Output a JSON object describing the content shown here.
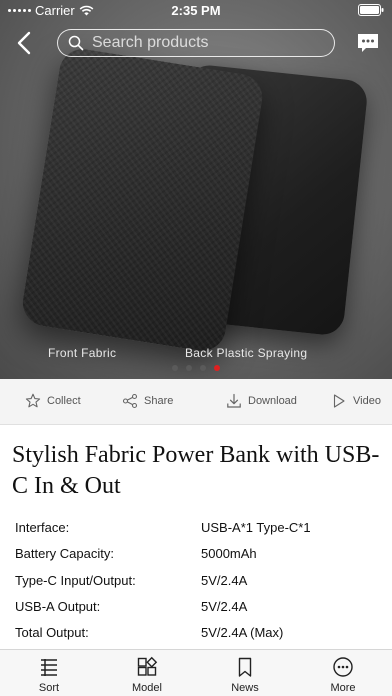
{
  "status_bar": {
    "carrier": "Carrier",
    "time": "2:35 PM"
  },
  "search": {
    "placeholder": "Search products"
  },
  "gallery": {
    "captions": [
      "Front  Fabric",
      "Back Plastic Spraying"
    ],
    "active_index": 3,
    "count": 4,
    "active_dot_color": "#e02020"
  },
  "actions": [
    {
      "label": "Collect",
      "icon": "star-icon"
    },
    {
      "label": "Share",
      "icon": "share-icon"
    },
    {
      "label": "Download",
      "icon": "download-icon"
    },
    {
      "label": "Video",
      "icon": "play-icon"
    }
  ],
  "product": {
    "title": "Stylish Fabric Power Bank with USB-C In & Out",
    "specs": [
      {
        "label": "Interface:",
        "value": "USB-A*1 Type-C*1"
      },
      {
        "label": "Battery Capacity:",
        "value": "5000mAh"
      },
      {
        "label": "Type-C Input/Output:",
        "value": "5V/2.4A"
      },
      {
        "label": "USB-A Output:",
        "value": "5V/2.4A"
      },
      {
        "label": "Total Output:",
        "value": "5V/2.4A (Max)"
      }
    ]
  },
  "tabbar": [
    {
      "label": "Sort",
      "icon": "list-icon"
    },
    {
      "label": "Model",
      "icon": "grid-icon"
    },
    {
      "label": "News",
      "icon": "bookmark-icon"
    },
    {
      "label": "More",
      "icon": "more-icon"
    }
  ]
}
